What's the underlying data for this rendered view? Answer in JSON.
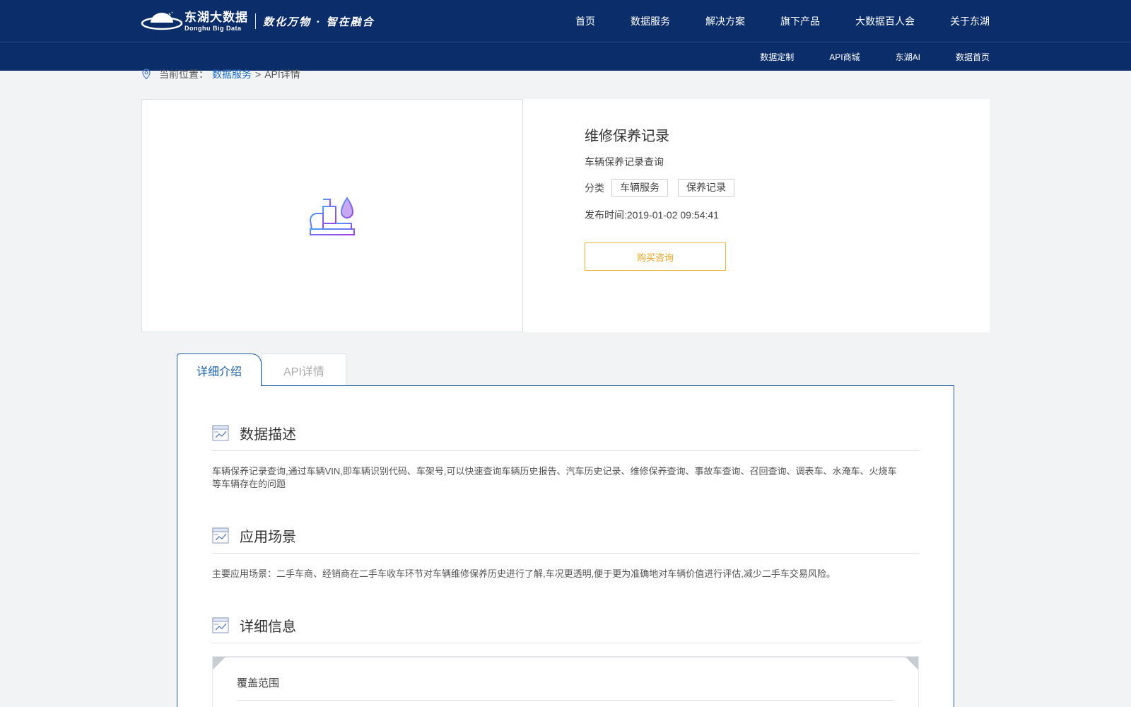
{
  "header": {
    "logo_cn": "东湖大数据",
    "logo_en": "Donghu Big Data",
    "slogan": "数化万物 · 智在融合",
    "nav": [
      "首页",
      "数据服务",
      "解决方案",
      "旗下产品",
      "大数据百人会",
      "关于东湖"
    ],
    "subnav": [
      "数据定制",
      "API商城",
      "东湖AI",
      "数据首页"
    ]
  },
  "breadcrumb": {
    "label": "当前位置：",
    "link": "数据服务",
    "separator": ">",
    "current": "API详情"
  },
  "product": {
    "image_icon": "car-seat-oil-drop-icon",
    "title": "维修保养记录",
    "subtitle": "车辆保养记录查询",
    "category_label": "分类",
    "tags": [
      "车辆服务",
      "保养记录"
    ],
    "publish_time": "发布时间:2019-01-02 09:54:41",
    "buy_button": "购买咨询"
  },
  "tabs": [
    {
      "label": "详细介绍",
      "active": true
    },
    {
      "label": "API详情",
      "active": false
    }
  ],
  "sections": [
    {
      "title": "数据描述",
      "body": "车辆保养记录查询,通过车辆VIN,即车辆识别代码、车架号,可以快速查询车辆历史报告、汽车历史记录、维修保养查询、事故车查询、召回查询、调表车、水淹车、火烧车等车辆存在的问题"
    },
    {
      "title": "应用场景",
      "body": "主要应用场景：二手车商、经销商在二手车收车环节对车辆维修保养历史进行了解,车况更透明,便于更为准确地对车辆价值进行评估,减少二手车交易风险。"
    },
    {
      "title": "详细信息",
      "body": ""
    }
  ],
  "detail": {
    "coverage_label": "覆盖范围"
  },
  "colors": {
    "header_bg": "#0b2e6b",
    "accent_blue": "#1a5fa8",
    "button_orange": "#e8a21e"
  }
}
